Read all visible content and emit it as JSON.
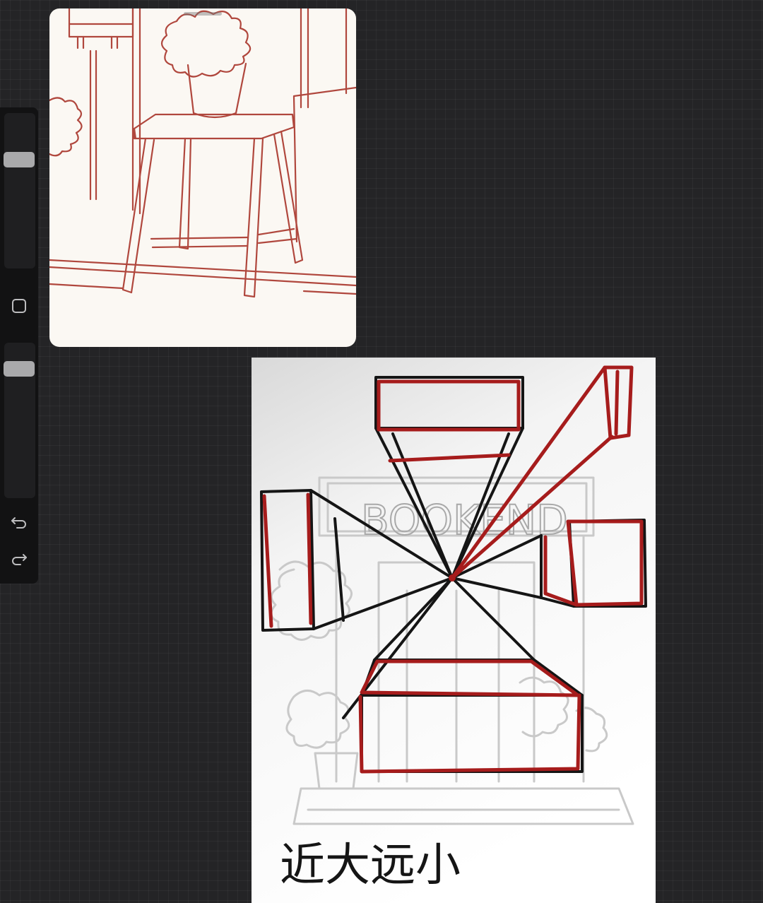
{
  "colors": {
    "background": "#242426",
    "sidebar": "#121213",
    "slider_thumb": "#a9a9ab",
    "sketch_red": "#a61c1c",
    "sketch_black": "#151515",
    "reference_line": "#b0473d",
    "reference_paper": "#fbf8f3"
  },
  "sidebar": {
    "brush_size_level": 0.3,
    "opacity_level": 0.15,
    "icons": {
      "modify": "square-icon",
      "undo": "undo-icon",
      "redo": "redo-icon"
    }
  },
  "reference": {
    "subject": "stool-sketch"
  },
  "canvas": {
    "sign_text": "BOOKEND",
    "caption": "近大远小"
  }
}
